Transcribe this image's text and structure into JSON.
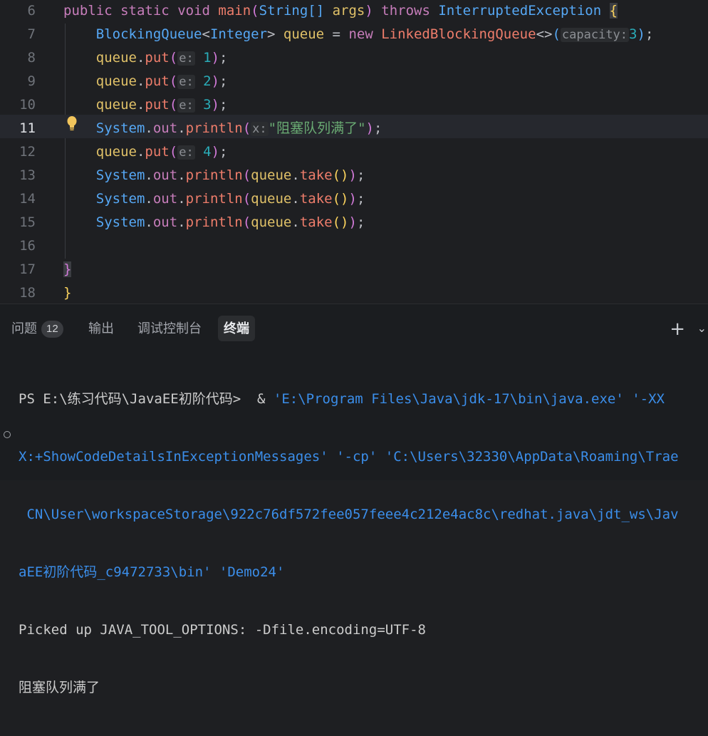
{
  "editor": {
    "lines": [
      {
        "number": "6"
      },
      {
        "number": "7"
      },
      {
        "number": "8"
      },
      {
        "number": "9"
      },
      {
        "number": "10"
      },
      {
        "number": "11"
      },
      {
        "number": "12"
      },
      {
        "number": "13"
      },
      {
        "number": "14"
      },
      {
        "number": "15"
      },
      {
        "number": "16"
      },
      {
        "number": "17"
      },
      {
        "number": "18"
      }
    ],
    "tokens": {
      "public": "public",
      "static": "static",
      "void": "void",
      "main": "main",
      "string_arr": "String[]",
      "args": "args",
      "throws": "throws",
      "exc": "InterruptedException",
      "bq": "BlockingQueue",
      "integer": "Integer",
      "queue": "queue",
      "new": "new",
      "lbq": "LinkedBlockingQueue",
      "capacity_hint": "capacity:",
      "cap_val": "3",
      "put": "put",
      "e_hint": "e:",
      "v1": "1",
      "v2": "2",
      "v3": "3",
      "v4": "4",
      "system": "System",
      "out": "out",
      "println": "println",
      "x_hint": "x:",
      "msg": "\"阻塞队列满了\"",
      "take": "take"
    }
  },
  "panel": {
    "tabs": [
      {
        "label": "问题",
        "badge": "12"
      },
      {
        "label": "输出"
      },
      {
        "label": "调试控制台"
      },
      {
        "label": "终端"
      }
    ],
    "add": "+",
    "more": "⌄",
    "terminal": {
      "prompt": "PS E:\\练习代码\\JavaEE初阶代码> ",
      "cmd_amp": " & ",
      "cmd_1": "'E:\\Program Files\\Java\\jdk-17\\bin\\java.exe' '-XX",
      "cmd_2": "X:+ShowCodeDetailsInExceptionMessages' '-cp' 'C:\\Users\\32330\\AppData\\Roaming\\Trae",
      "cmd_3": " CN\\User\\workspaceStorage\\922c76df572fee057feee4c212e4ac8c\\redhat.java\\jdt_ws\\Jav",
      "cmd_4": "aEE初阶代码_c9472733\\bin' 'Demo24'",
      "out_1": "Picked up JAVA_TOOL_OPTIONS: -Dfile.encoding=UTF-8",
      "out_2": "阻塞队列满了"
    }
  }
}
